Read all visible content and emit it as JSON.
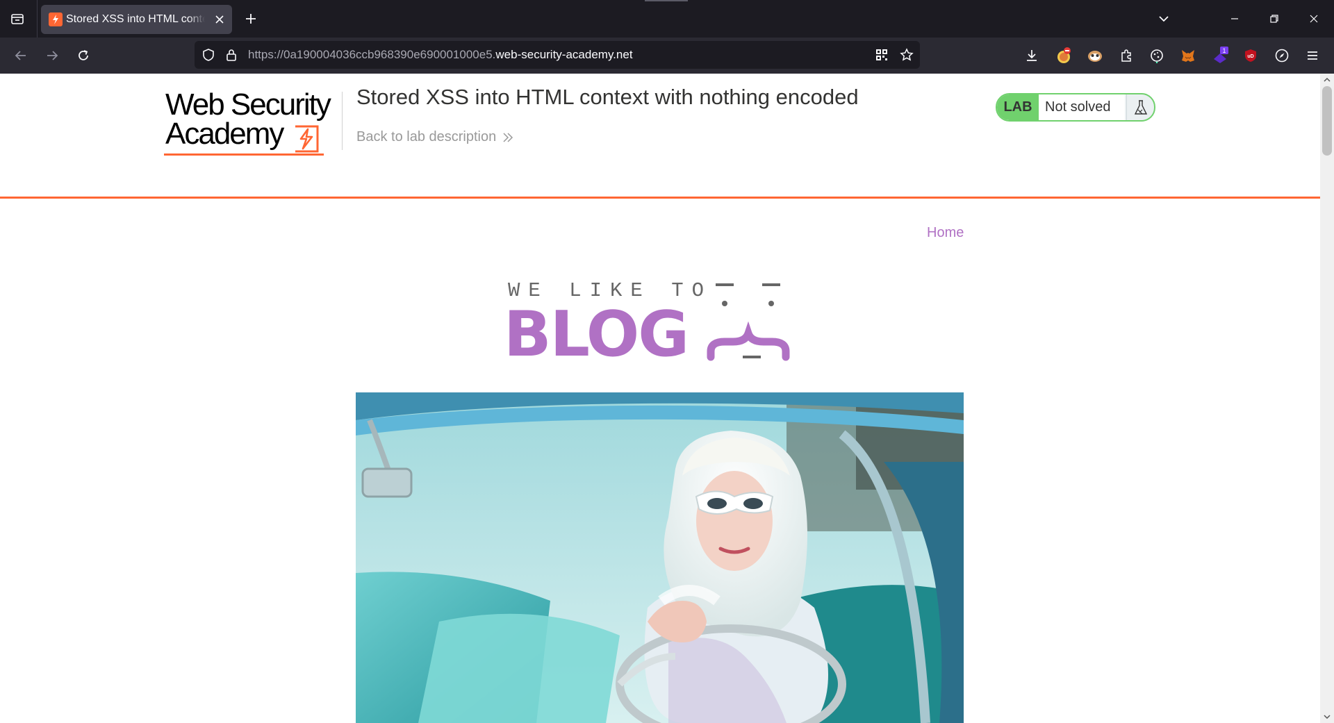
{
  "browser": {
    "tab": {
      "title": "Stored XSS into HTML context with nothing encoded"
    },
    "url": {
      "prefix": "https://0a190004036ccb968390e690001000e5.",
      "domain": "web-security-academy.net"
    },
    "extensions": [
      "download-icon",
      "adblock-icon",
      "privacy-badger-icon",
      "extensions-puzzle-icon",
      "cookie-icon",
      "metamask-icon",
      "notification-extension-icon",
      "ublock-icon",
      "compass-icon"
    ],
    "extension_badge": "1",
    "ublock_label": "uD"
  },
  "academy": {
    "logo": {
      "line1": "Web Security",
      "line2": "Academy"
    },
    "lab_title": "Stored XSS into HTML context with nothing encoded",
    "back_link": "Back to lab description",
    "status": {
      "lab": "LAB",
      "state": "Not solved"
    }
  },
  "blog": {
    "nav": {
      "home": "Home"
    },
    "banner": {
      "top": "WE LIKE TO",
      "main": "BLOG"
    }
  },
  "colors": {
    "accent": "#ff6633",
    "blog": "#b071c4",
    "solved_green": "#70d16d"
  }
}
